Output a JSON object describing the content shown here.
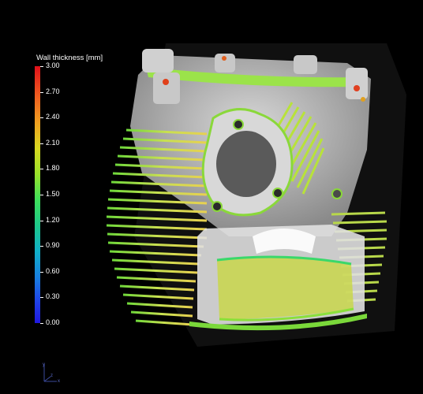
{
  "legend": {
    "title": "Wall thickness [mm]",
    "ticks": [
      "3.00",
      "2.70",
      "2.40",
      "2.10",
      "1.80",
      "1.50",
      "1.20",
      "0.90",
      "0.60",
      "0.30",
      "0.00"
    ]
  },
  "triad": {
    "y": "y",
    "x": "x",
    "z": "z"
  },
  "colors": {
    "background": "#000000",
    "scale_max": "#e0101a",
    "scale_mid": "#3ee05a",
    "scale_min": "#2018e0"
  }
}
